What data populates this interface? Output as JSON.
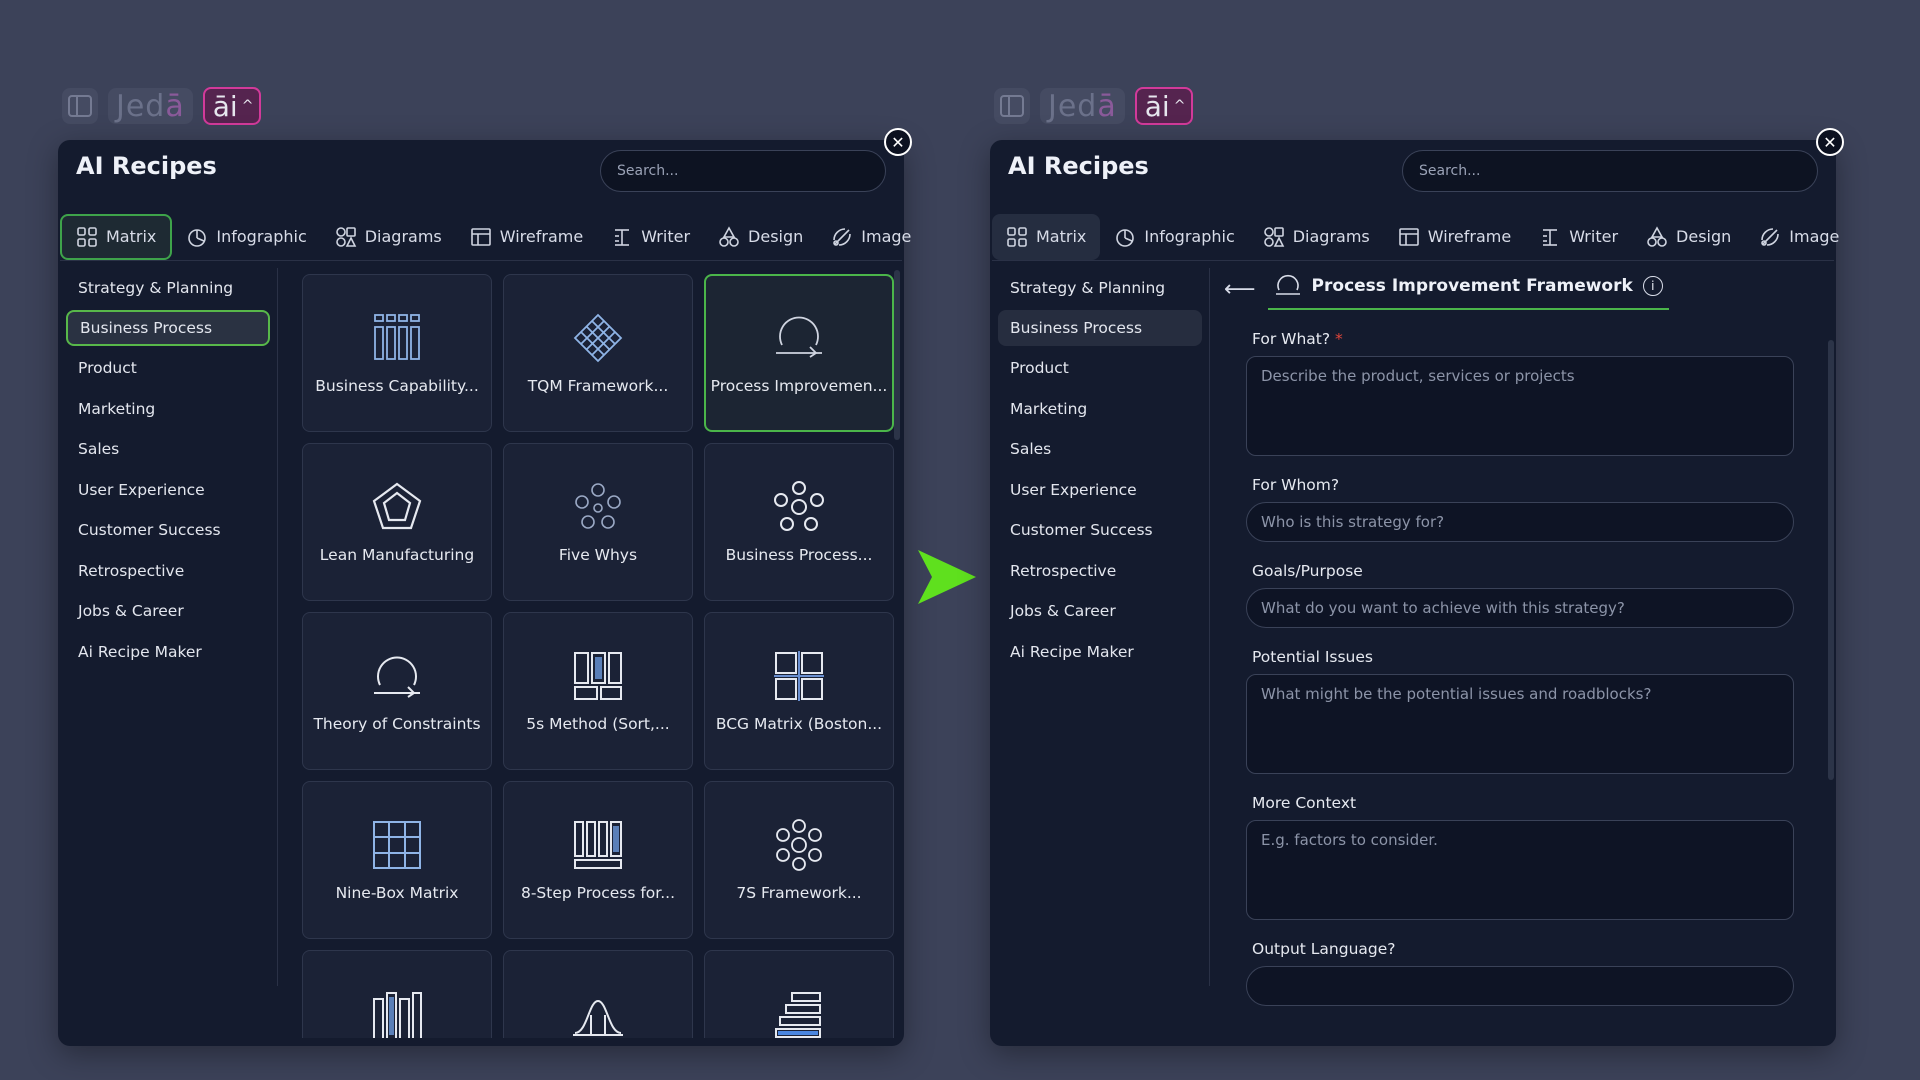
{
  "left": {
    "topbar": {
      "logo_main": "Jed",
      "logo_accent": "ā",
      "ai_label": "āi",
      "ai_chevron": "^"
    },
    "title": "AI Recipes",
    "search_placeholder": "Search...",
    "tabs": [
      {
        "label": "Matrix",
        "icon": "grid-icon"
      },
      {
        "label": "Infographic",
        "icon": "pie-icon"
      },
      {
        "label": "Diagrams",
        "icon": "shapes-icon"
      },
      {
        "label": "Wireframe",
        "icon": "wireframe-icon"
      },
      {
        "label": "Writer",
        "icon": "writer-icon"
      },
      {
        "label": "Design",
        "icon": "design-icon"
      },
      {
        "label": "Image",
        "icon": "image-icon"
      }
    ],
    "sidebar": [
      "Strategy & Planning",
      "Business Process",
      "Product",
      "Marketing",
      "Sales",
      "User Experience",
      "Customer Success",
      "Retrospective",
      "Jobs & Career",
      "Ai Recipe Maker"
    ],
    "cards": [
      {
        "label": "Business Capability...",
        "icon": "capability-icon"
      },
      {
        "label": "TQM Framework...",
        "icon": "diamond-grid-icon"
      },
      {
        "label": "Process Improvemen...",
        "icon": "cycle-icon"
      },
      {
        "label": "Lean Manufacturing",
        "icon": "pentagon-icon"
      },
      {
        "label": "Five Whys",
        "icon": "five-circles-icon"
      },
      {
        "label": "Business Process...",
        "icon": "flower-icon"
      },
      {
        "label": "Theory of Constraints",
        "icon": "cycle-icon"
      },
      {
        "label": "5s Method (Sort,...",
        "icon": "columns-icon"
      },
      {
        "label": "BCG Matrix (Boston...",
        "icon": "quadrant-icon"
      },
      {
        "label": "Nine-Box Matrix",
        "icon": "nine-box-icon"
      },
      {
        "label": "8-Step Process for...",
        "icon": "steps-icon"
      },
      {
        "label": "7S Framework...",
        "icon": "seven-circles-icon"
      },
      {
        "label": "",
        "icon": "bars-icon"
      },
      {
        "label": "",
        "icon": "bell-curve-icon"
      },
      {
        "label": "",
        "icon": "stack-icon"
      }
    ]
  },
  "right": {
    "topbar": {
      "logo_main": "Jed",
      "logo_accent": "ā",
      "ai_label": "āi",
      "ai_chevron": "^"
    },
    "title": "AI Recipes",
    "search_placeholder": "Search...",
    "tabs": [
      {
        "label": "Matrix",
        "icon": "grid-icon"
      },
      {
        "label": "Infographic",
        "icon": "pie-icon"
      },
      {
        "label": "Diagrams",
        "icon": "shapes-icon"
      },
      {
        "label": "Wireframe",
        "icon": "wireframe-icon"
      },
      {
        "label": "Writer",
        "icon": "writer-icon"
      },
      {
        "label": "Design",
        "icon": "design-icon"
      },
      {
        "label": "Image",
        "icon": "image-icon"
      }
    ],
    "sidebar": [
      "Strategy & Planning",
      "Business Process",
      "Product",
      "Marketing",
      "Sales",
      "User Experience",
      "Customer Success",
      "Retrospective",
      "Jobs & Career",
      "Ai Recipe Maker"
    ],
    "form": {
      "back": "⟵",
      "title": "Process Improvement Framework",
      "info": "i",
      "fields": [
        {
          "label": "For What?",
          "required": "*",
          "placeholder": "Describe the product, services or projects",
          "type": "textarea"
        },
        {
          "label": "For Whom?",
          "required": "",
          "placeholder": "Who is this strategy for?",
          "type": "input"
        },
        {
          "label": "Goals/Purpose",
          "required": "",
          "placeholder": "What do you want to achieve with this strategy?",
          "type": "input"
        },
        {
          "label": "Potential Issues",
          "required": "",
          "placeholder": "What might be the potential issues and roadblocks?",
          "type": "textarea"
        },
        {
          "label": "More Context",
          "required": "",
          "placeholder": "E.g. factors to consider.",
          "type": "textarea"
        },
        {
          "label": "Output Language?",
          "required": "",
          "placeholder": "",
          "type": "input"
        }
      ]
    }
  },
  "colors": {
    "bg": "#3c4259",
    "panel": "#141b2e",
    "accent_green": "#4bb54a",
    "arrow_green": "#5fe01e",
    "ai_pink": "#d23a9a"
  }
}
